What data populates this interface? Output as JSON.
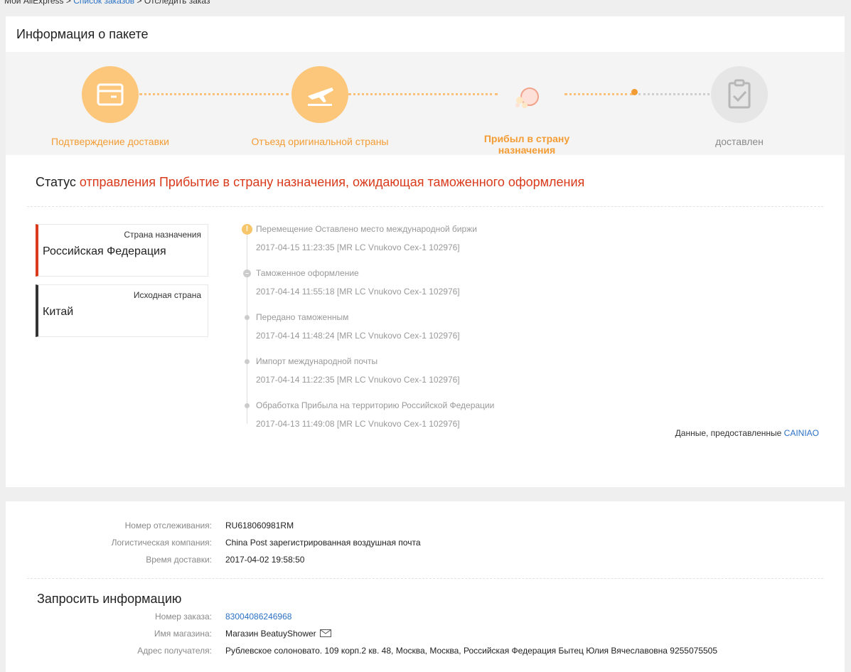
{
  "breadcrumb": {
    "home": "Мой AliExpress",
    "sep1": ">",
    "orders": "Список заказов",
    "sep2": ">",
    "current": "Отследить заказ"
  },
  "package": {
    "title": "Информация о пакете",
    "steps": [
      {
        "label": "Подтверждение доставки",
        "icon": "package-icon",
        "state": "done"
      },
      {
        "label": "Отъезд оригинальной страны",
        "icon": "plane-departure-icon",
        "state": "done"
      },
      {
        "label": "Прибыл в страну назначения",
        "icon": "balloon-icon",
        "state": "current"
      },
      {
        "label": "доставлен",
        "icon": "clipboard-check-icon",
        "state": "pending"
      }
    ]
  },
  "status": {
    "prefix": "Статус",
    "text": "отправления Прибытие в страну назначения, ожидающая таможенного оформления"
  },
  "countries": {
    "dest_label": "Страна назначения",
    "dest_value": "Российская Федерация",
    "origin_label": "Исходная страна",
    "origin_value": "Китай"
  },
  "events": [
    {
      "title": "Перемещение Оставлено место международной биржи",
      "datetime": "2017-04-15 11:23:35 [MR LC Vnukovo Cex-1 102976]"
    },
    {
      "title": "Таможенное оформление",
      "datetime": "2017-04-14 11:55:18 [MR LC Vnukovo Cex-1 102976]"
    },
    {
      "title": "Передано таможенным",
      "datetime": "2017-04-14 11:48:24 [MR LC Vnukovo Cex-1 102976]"
    },
    {
      "title": "Импорт международной почты",
      "datetime": "2017-04-14 11:22:35 [MR LC Vnukovo Cex-1 102976]"
    },
    {
      "title": "Обработка Прибыла на территорию Российской Федерации",
      "datetime": "2017-04-13 11:49:08 [MR LC Vnukovo Cex-1 102976]"
    }
  ],
  "provided": {
    "text": "Данные, предоставленные",
    "link": "CAINIAO"
  },
  "shipping": {
    "tracking_label": "Номер отслеживания:",
    "tracking_value": "RU618060981RM",
    "company_label": "Логистическая компания:",
    "company_value": "China Post зарегистрированная воздушная почта",
    "time_label": "Время доставки:",
    "time_value": "2017-04-02 19:58:50"
  },
  "request": {
    "title": "Запросить информацию",
    "order_label": "Номер заказа:",
    "order_value": "83004086246968",
    "shop_label": "Имя магазина:",
    "shop_value": "Магазин BeatuyShower",
    "address_label": "Адрес получателя:",
    "address_value": "Рублевское солоновато. 109 корп.2 кв. 48, Москва, Москва, Российская Федерация Бытец Юлия Вячеславовна 9255075505"
  },
  "colors": {
    "accent": "#f39c33",
    "step_done": "#fcc77b",
    "status_red": "#d93a1c",
    "link": "#2a71c4"
  }
}
